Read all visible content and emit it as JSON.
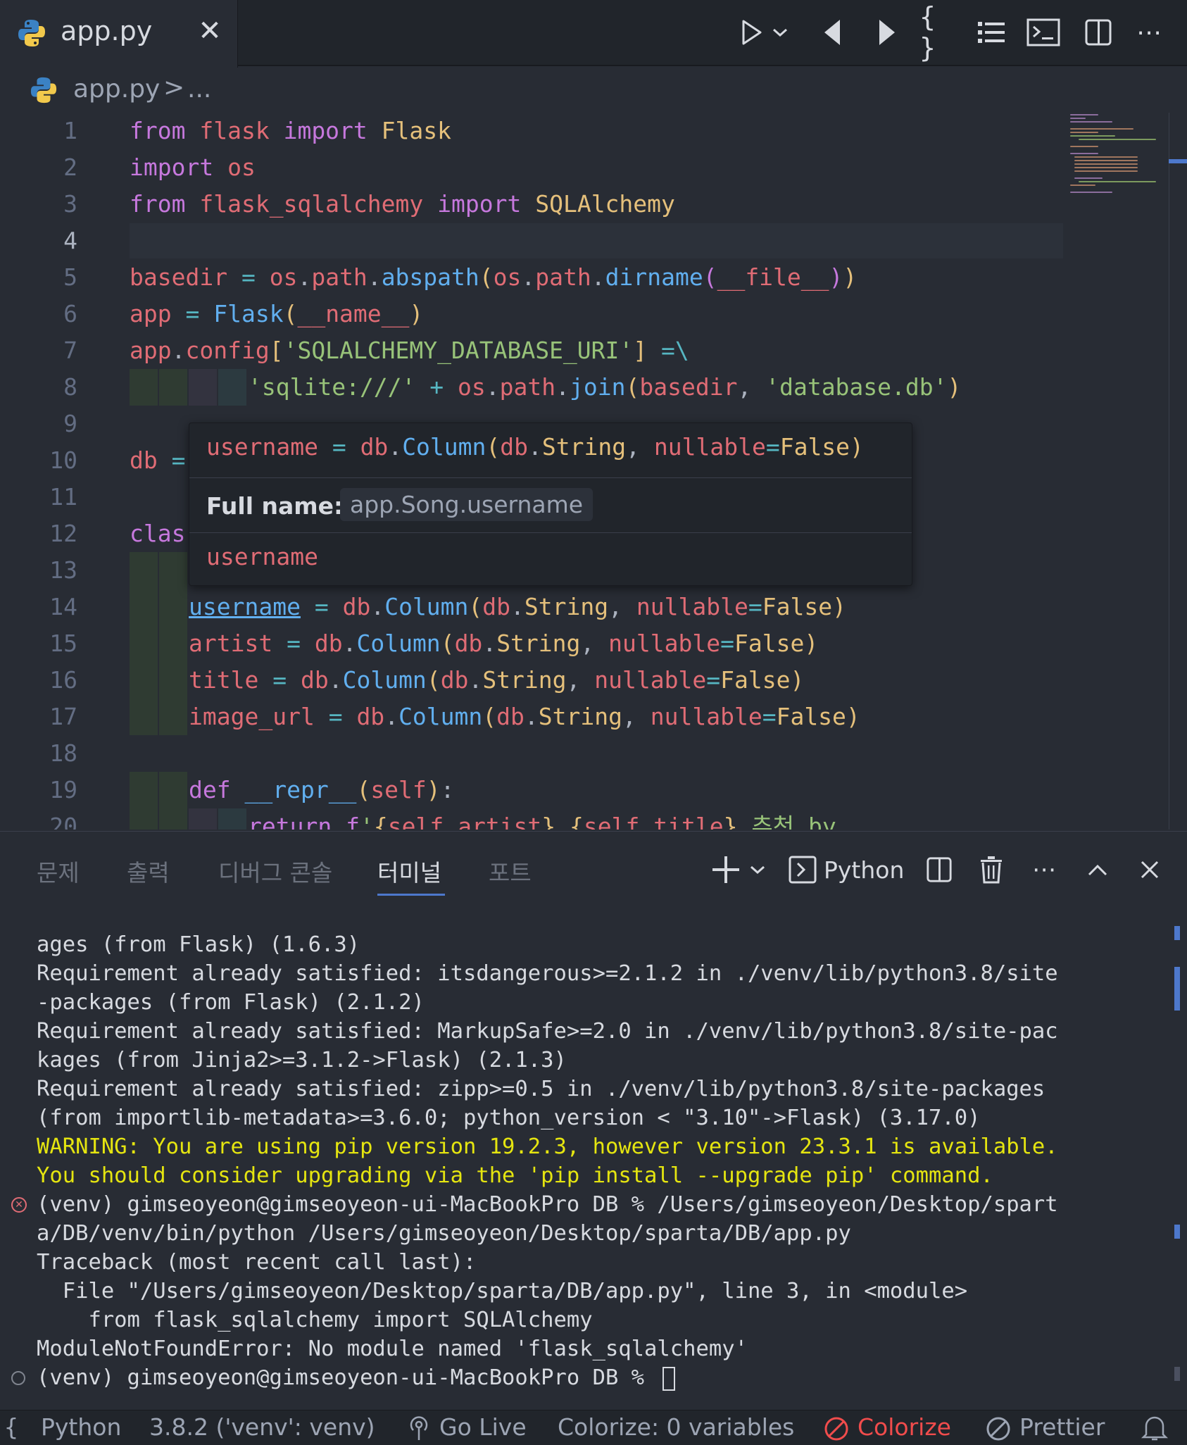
{
  "tab": {
    "filename": "app.py",
    "close_glyph": "✕"
  },
  "toolbar": {
    "run": "run-icon",
    "run_menu": "chevron-down-icon",
    "prev": "previous-change-icon",
    "next": "next-change-icon",
    "braces": "{ }",
    "outline": "list-icon",
    "terminal": "terminal-icon",
    "split": "split-editor-icon",
    "more": "⋯"
  },
  "breadcrumb": {
    "file": "app.py",
    "separator": ">",
    "more": "..."
  },
  "editor": {
    "line_numbers": [
      "1",
      "2",
      "3",
      "4",
      "5",
      "6",
      "7",
      "8",
      "9",
      "10",
      "11",
      "12",
      "13",
      "14",
      "15",
      "16",
      "17",
      "18",
      "19",
      "20"
    ],
    "active_line": "4"
  },
  "hover": {
    "signature": {
      "name": "username",
      "eq": " = ",
      "obj": "db",
      "dot1": ".",
      "fn": "Column",
      "open": "(",
      "arg_obj": "db",
      "dot2": ".",
      "arg_type": "String",
      "comma": ", ",
      "kw": "nullable",
      "kweq": "=",
      "val": "False",
      "close": ")"
    },
    "full_name_label": "Full name:",
    "full_name_value": "app.Song.username",
    "doc": "username"
  },
  "panel": {
    "tabs": [
      "문제",
      "출력",
      "디버그 콘솔",
      "터미널",
      "포트"
    ],
    "active_tab": "터미널",
    "shell_label": "Python"
  },
  "terminal": {
    "lines": [
      "ages (from Flask) (1.6.3)",
      "Requirement already satisfied: itsdangerous>=2.1.2 in ./venv/lib/python3.8/site",
      "-packages (from Flask) (2.1.2)",
      "Requirement already satisfied: MarkupSafe>=2.0 in ./venv/lib/python3.8/site-pac",
      "kages (from Jinja2>=3.1.2->Flask) (2.1.3)",
      "Requirement already satisfied: zipp>=0.5 in ./venv/lib/python3.8/site-packages",
      "(from importlib-metadata>=3.6.0; python_version < \"3.10\"->Flask) (3.17.0)",
      "WARNING: You are using pip version 19.2.3, however version 23.3.1 is available.",
      "You should consider upgrading via the 'pip install --upgrade pip' command.",
      "(venv) gimseoyeon@gimseoyeon-ui-MacBookPro DB % /Users/gimseoyeon/Desktop/spart",
      "a/DB/venv/bin/python /Users/gimseoyeon/Desktop/sparta/DB/app.py",
      "Traceback (most recent call last):",
      "  File \"/Users/gimseoyeon/Desktop/sparta/DB/app.py\", line 3, in <module>",
      "    from flask_sqlalchemy import SQLAlchemy",
      "ModuleNotFoundError: No module named 'flask_sqlalchemy'",
      "(venv) gimseoyeon@gimseoyeon-ui-MacBookPro DB % "
    ]
  },
  "statusbar": {
    "language": "Python",
    "interpreter": "3.8.2 ('venv': venv)",
    "go_live": "Go Live",
    "colorize_vars": "Colorize: 0 variables",
    "colorize": "Colorize",
    "prettier": "Prettier"
  },
  "colors": {
    "accent": "#4d78cc",
    "error": "#f14c4c",
    "warning": "#e5e510"
  }
}
